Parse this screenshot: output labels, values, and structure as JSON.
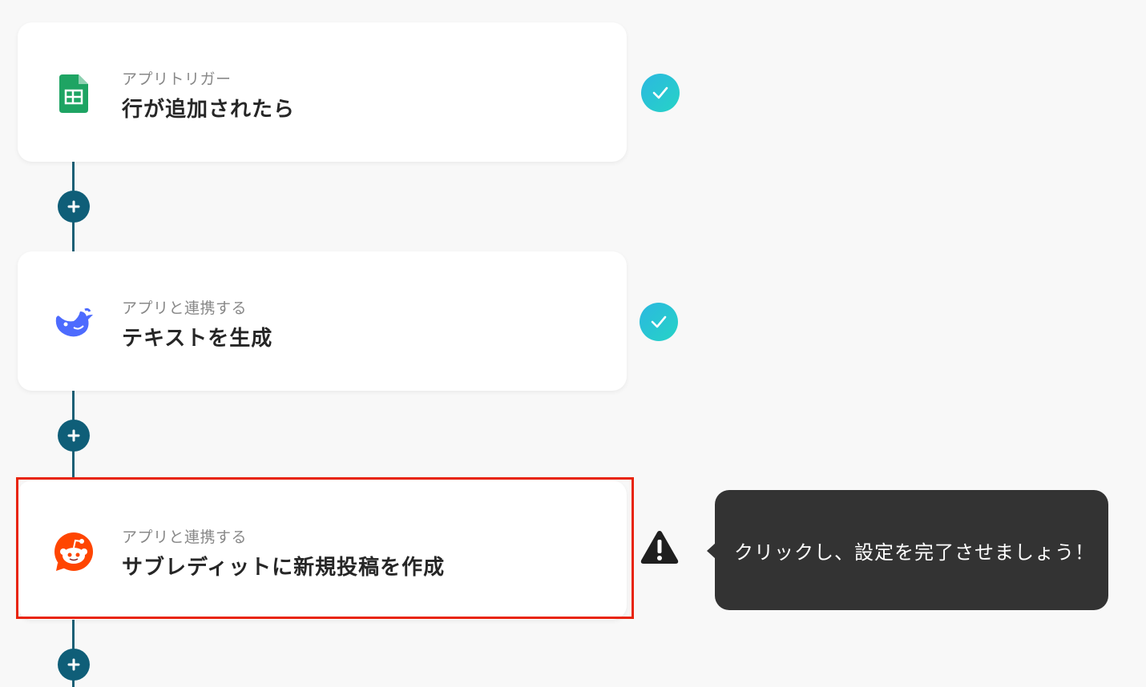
{
  "steps": [
    {
      "kind": "アプリトリガー",
      "title": "行が追加されたら",
      "app_icon": "google-sheets-icon",
      "status": "complete"
    },
    {
      "kind": "アプリと連携する",
      "title": "テキストを生成",
      "app_icon": "deepseek-icon",
      "status": "complete"
    },
    {
      "kind": "アプリと連携する",
      "title": "サブレディットに新規投稿を作成",
      "app_icon": "reddit-icon",
      "status": "warning"
    }
  ],
  "tooltip": {
    "text": "クリックし、設定を完了させましょう！"
  },
  "colors": {
    "connector": "#1b5f75",
    "plus_button": "#0f5e78",
    "check_gradient_start": "#2bb8e0",
    "check_gradient_end": "#26d3c6",
    "highlight_border": "#e8240b",
    "tooltip_bg": "#333333"
  }
}
